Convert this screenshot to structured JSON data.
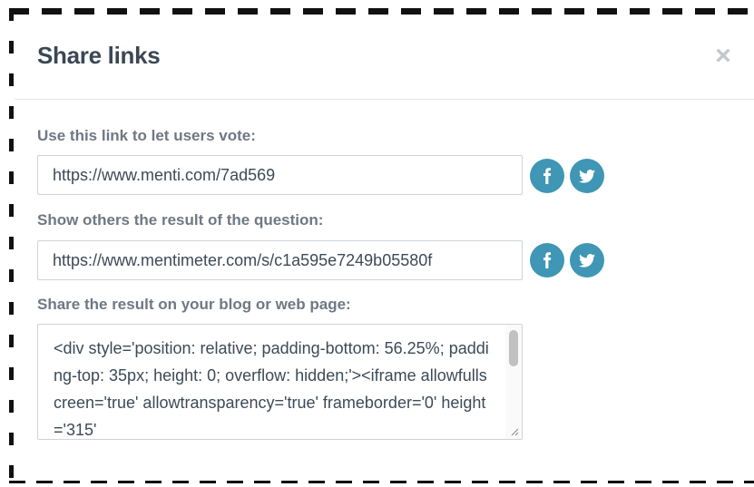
{
  "dialog": {
    "title": "Share links",
    "close_symbol": "×"
  },
  "vote_link": {
    "label": "Use this link to let users vote:",
    "value": "https://www.menti.com/7ad569"
  },
  "result_link": {
    "label": "Show others the result of the question:",
    "value": "https://www.mentimeter.com/s/c1a595e7249b05580f"
  },
  "embed": {
    "label": "Share the result on your blog or web page:",
    "value": "<div style='position: relative; padding-bottom: 56.25%; padding-top: 35px; height: 0; overflow: hidden;'><iframe allowfullscreen='true' allowtransparency='true' frameborder='0' height='315'"
  },
  "social": {
    "facebook_icon": "facebook-icon",
    "twitter_icon": "twitter-icon",
    "color": "#3f96b5"
  }
}
